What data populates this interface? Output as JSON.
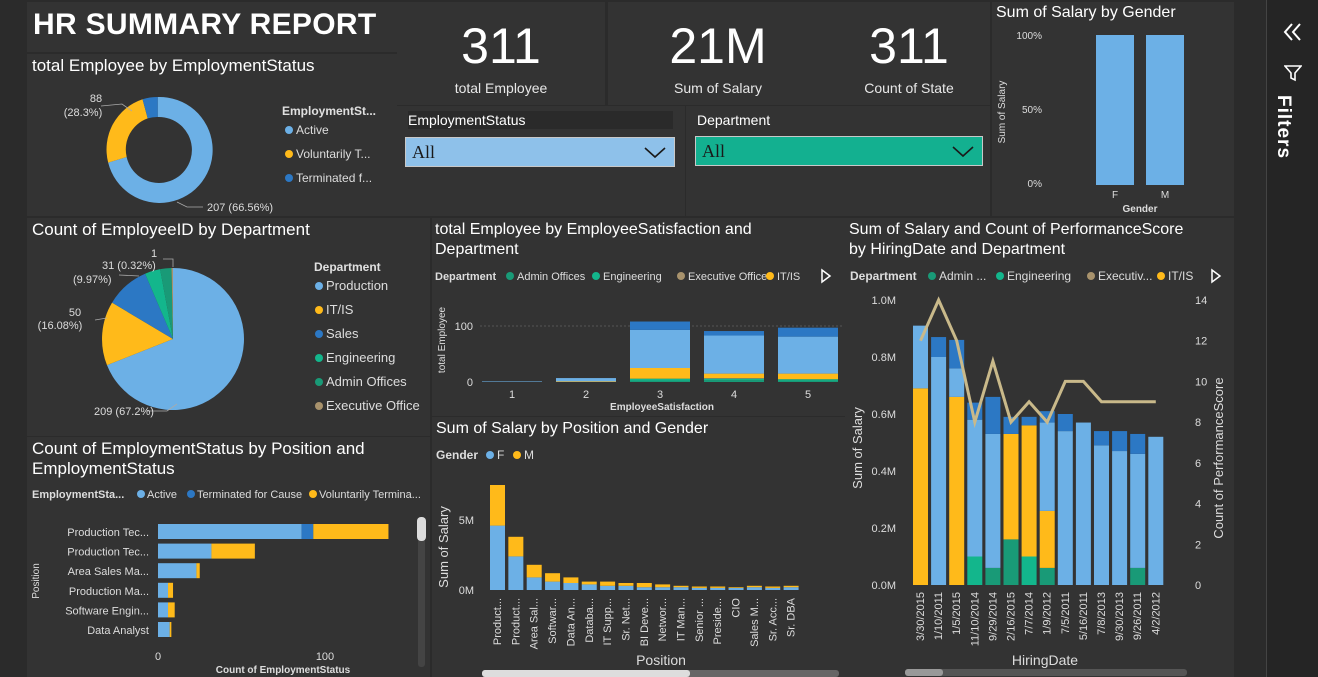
{
  "report_title": "HR SUMMARY REPORT",
  "kpis": [
    {
      "value": "311",
      "label": "total Employee"
    },
    {
      "value": "21M",
      "label": "Sum of Salary"
    },
    {
      "value": "311",
      "label": "Count of State"
    }
  ],
  "slicers": [
    {
      "title": "EmploymentStatus",
      "value": "All"
    },
    {
      "title": "Department",
      "value": "All"
    }
  ],
  "filters_pane": {
    "label": "Filters"
  },
  "colors": {
    "blue_light": "#6cb0e6",
    "yellow": "#ffba1a",
    "blue_dark": "#2c78c4",
    "teal": "#199a77",
    "green": "#13b68c",
    "tan": "#a8926c",
    "line": "#c9b98a",
    "slicer_blue": "#8ec1ea",
    "slicer_teal": "#13b090"
  },
  "donut": {
    "title": "total Employee by EmploymentStatus",
    "legend_title": "EmploymentSt...",
    "legend": [
      "Active",
      "Voluntarily T...",
      "Terminated f..."
    ],
    "labels": {
      "active": "207 (66.56%)",
      "vol_line1": "88",
      "vol_line2": "(28.3%)"
    }
  },
  "gender_chart": {
    "title": "Sum of Salary by Gender",
    "ylabel": "Sum of Salary",
    "xlabel": "Gender",
    "ticks": [
      "100%",
      "50%",
      "0%"
    ],
    "categories": [
      "F",
      "M"
    ]
  },
  "dept_pie": {
    "title": "Count of EmployeeID by Department",
    "legend_title": "Department",
    "legend": [
      "Production",
      "IT/IS",
      "Sales",
      "Engineering",
      "Admin Offices",
      "Executive Office"
    ],
    "labels": {
      "prod": "209 (67.2%)",
      "itis1": "50",
      "itis2": "(16.08%)",
      "sales1": "31 (0.32%)",
      "sales2": "(9.97%)",
      "exec": "1"
    }
  },
  "satisfaction_chart": {
    "title_line1": "total Employee by EmployeeSatisfaction and",
    "title_line2": "Department",
    "legend_title": "Department",
    "legend": [
      "Admin Offices",
      "Engineering",
      "Executive Office",
      "IT/IS"
    ],
    "ylabel": "total Employee",
    "xlabel": "EmployeeSatisfaction",
    "yticks": [
      "100",
      "0"
    ],
    "categories": [
      "1",
      "2",
      "3",
      "4",
      "5"
    ]
  },
  "perf_chart": {
    "title_line1": "Sum of Salary and Count of PerformanceScore",
    "title_line2": "by HiringDate and Department",
    "legend_title": "Department",
    "legend": [
      "Admin ...",
      "Engineering",
      "Executiv...",
      "IT/IS"
    ],
    "ylabel_left": "Sum of Salary",
    "ylabel_right": "Count of PerformanceScore",
    "xlabel": "HiringDate",
    "left_ticks": [
      "1.0M",
      "0.8M",
      "0.6M",
      "0.4M",
      "0.2M",
      "0.0M"
    ],
    "right_ticks": [
      "14",
      "12",
      "10",
      "8",
      "6",
      "4",
      "2",
      "0"
    ],
    "dates": [
      "3/30/2015",
      "1/10/2011",
      "1/5/2015",
      "11/10/2014",
      "9/29/2014",
      "2/16/2015",
      "7/7/2014",
      "1/9/2012",
      "7/5/2011",
      "5/16/2011",
      "7/8/2013",
      "9/30/2013",
      "9/26/2011",
      "4/2/2012"
    ]
  },
  "emp_position_chart": {
    "title_line1": "Count of EmploymentStatus by Position and",
    "title_line2": "EmploymentStatus",
    "legend_title": "EmploymentSta...",
    "legend": [
      "Active",
      "Terminated for Cause",
      "Voluntarily Termina..."
    ],
    "ylabel": "Position",
    "xlabel": "Count of EmploymentStatus",
    "xticks": [
      "0",
      "100"
    ],
    "categories": [
      "Production Tec...",
      "Production Tec...",
      "Area Sales Ma...",
      "Production Ma...",
      "Software Engin...",
      "Data Analyst"
    ]
  },
  "salary_position_chart": {
    "title": "Sum of Salary by Position and Gender",
    "legend_title": "Gender",
    "legend": [
      "F",
      "M"
    ],
    "ylabel": "Sum of Salary",
    "xlabel": "Position",
    "yticks": [
      "5M",
      "0M"
    ],
    "categories": [
      "Product...",
      "Product...",
      "Area Sal...",
      "Softwar...",
      "Data An...",
      "Databa...",
      "IT Supp...",
      "Sr. Net...",
      "BI Deve...",
      "Networ...",
      "IT Man...",
      "Senior ...",
      "Preside...",
      "CIO",
      "Sales M...",
      "Sr. Acc...",
      "Sr. DBA"
    ]
  },
  "chart_data": [
    {
      "type": "pie",
      "title": "total Employee by EmploymentStatus",
      "categories": [
        "Active",
        "Voluntarily Terminated",
        "Terminated for Cause"
      ],
      "values": [
        207,
        88,
        16
      ]
    },
    {
      "type": "bar",
      "title": "Sum of Salary by Gender",
      "xlabel": "Gender",
      "ylabel": "Sum of Salary",
      "categories": [
        "F",
        "M"
      ],
      "values": [
        100,
        100
      ],
      "ylim": [
        0,
        100
      ]
    },
    {
      "type": "pie",
      "title": "Count of EmployeeID by Department",
      "categories": [
        "Production",
        "IT/IS",
        "Sales",
        "Engineering",
        "Admin Offices",
        "Executive Office"
      ],
      "values": [
        209,
        50,
        31,
        11,
        9,
        1
      ]
    },
    {
      "type": "bar",
      "title": "total Employee by EmployeeSatisfaction and Department",
      "xlabel": "EmployeeSatisfaction",
      "ylabel": "total Employee",
      "categories": [
        "1",
        "2",
        "3",
        "4",
        "5"
      ],
      "series": [
        {
          "name": "Admin Offices",
          "values": [
            0,
            0,
            2,
            3,
            2
          ]
        },
        {
          "name": "Engineering",
          "values": [
            0,
            0,
            4,
            3,
            3
          ]
        },
        {
          "name": "Executive Office",
          "values": [
            0,
            0,
            0,
            1,
            0
          ]
        },
        {
          "name": "IT/IS",
          "values": [
            0,
            1,
            19,
            8,
            10
          ]
        },
        {
          "name": "Production",
          "values": [
            1,
            6,
            68,
            68,
            66
          ]
        },
        {
          "name": "Sales",
          "values": [
            0,
            0,
            15,
            8,
            16
          ]
        }
      ],
      "ylim": [
        0,
        110
      ]
    },
    {
      "type": "bar",
      "title": "Sum of Salary and Count of PerformanceScore by HiringDate and Department",
      "xlabel": "HiringDate",
      "ylabel": "Sum of Salary",
      "categories": [
        "3/30/2015",
        "1/10/2011",
        "1/5/2015",
        "11/10/2014",
        "9/29/2014",
        "2/16/2015",
        "7/7/2014",
        "1/9/2012",
        "7/5/2011",
        "5/16/2011",
        "7/8/2013",
        "9/30/2013",
        "9/26/2011",
        "4/2/2012"
      ],
      "series": [
        {
          "name": "Admin Offices",
          "values": [
            0,
            0,
            0,
            0,
            0.06,
            0.16,
            0,
            0.06,
            0,
            0,
            0,
            0,
            0.06,
            0
          ]
        },
        {
          "name": "Engineering",
          "values": [
            0,
            0,
            0,
            0.1,
            0,
            0,
            0.1,
            0,
            0,
            0,
            0,
            0,
            0,
            0
          ]
        },
        {
          "name": "IT/IS",
          "values": [
            0.69,
            0,
            0.66,
            0,
            0,
            0.37,
            0.46,
            0.2,
            0,
            0,
            0,
            0,
            0,
            0
          ]
        },
        {
          "name": "Production",
          "values": [
            0.22,
            0.8,
            0.1,
            0.48,
            0.47,
            0,
            0,
            0.31,
            0.54,
            0.57,
            0.49,
            0.47,
            0.4,
            0.52
          ]
        },
        {
          "name": "Sales",
          "values": [
            0,
            0.07,
            0.1,
            0.06,
            0.13,
            0.06,
            0.03,
            0.04,
            0.06,
            0,
            0.05,
            0.07,
            0.07,
            0
          ]
        },
        {
          "name": "Count of PerformanceScore",
          "values": [
            12,
            14,
            12,
            8,
            11,
            8,
            9,
            8,
            10,
            10,
            9,
            9,
            9,
            9
          ]
        }
      ],
      "ylim": [
        0,
        1.0
      ],
      "y2lim": [
        0,
        14
      ]
    },
    {
      "type": "bar",
      "title": "Count of EmploymentStatus by Position and EmploymentStatus",
      "xlabel": "Count of EmploymentStatus",
      "ylabel": "Position",
      "categories": [
        "Production Tec...",
        "Production Tec...",
        "Area Sales Ma...",
        "Production Ma...",
        "Software Engin...",
        "Data Analyst"
      ],
      "series": [
        {
          "name": "Active",
          "values": [
            86,
            32,
            23,
            6,
            6,
            7
          ]
        },
        {
          "name": "Terminated for Cause",
          "values": [
            7,
            0,
            0,
            0,
            0,
            0
          ]
        },
        {
          "name": "Voluntarily Terminated",
          "values": [
            45,
            26,
            2,
            3,
            4,
            1
          ]
        }
      ],
      "xlim": [
        0,
        150
      ]
    },
    {
      "type": "bar",
      "title": "Sum of Salary by Position and Gender",
      "xlabel": "Position",
      "ylabel": "Sum of Salary",
      "categories": [
        "Product...",
        "Product...",
        "Area Sal...",
        "Softwar...",
        "Data An...",
        "Databa...",
        "IT Supp...",
        "Sr. Net...",
        "BI Deve...",
        "Networ...",
        "IT Man...",
        "Senior ...",
        "Preside...",
        "CIO",
        "Sales M...",
        "Sr. Acc...",
        "Sr. DBA"
      ],
      "series": [
        {
          "name": "F",
          "values": [
            4.6,
            2.4,
            0.9,
            0.6,
            0.5,
            0.4,
            0.3,
            0.3,
            0.2,
            0.2,
            0.2,
            0.15,
            0.15,
            0.15,
            0.2,
            0.15,
            0.2
          ]
        },
        {
          "name": "M",
          "values": [
            2.9,
            1.4,
            0.9,
            0.6,
            0.4,
            0.2,
            0.3,
            0.2,
            0.3,
            0.2,
            0.1,
            0.1,
            0.1,
            0.05,
            0.1,
            0.1,
            0.1
          ]
        }
      ],
      "ylim": [
        0,
        8
      ]
    }
  ]
}
